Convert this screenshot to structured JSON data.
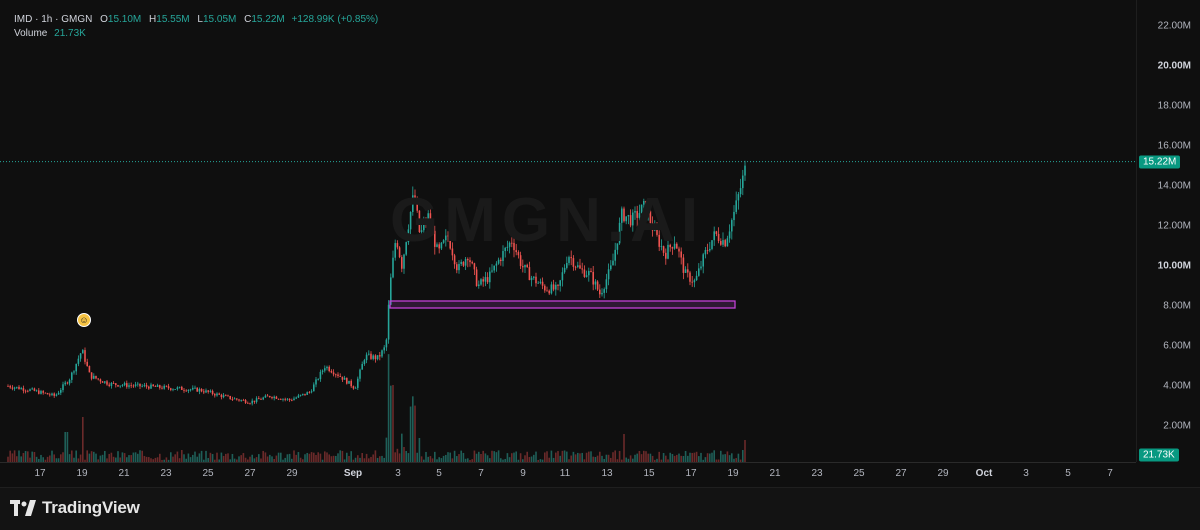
{
  "legend": {
    "symbol": "IMD · 1h · GMGN",
    "open_label": "O",
    "open": "15.10M",
    "high_label": "H",
    "high": "15.55M",
    "low_label": "L",
    "low": "15.05M",
    "close_label": "C",
    "close": "15.22M",
    "change": "+128.99K (+0.85%)",
    "volume_label": "Volume",
    "volume": "21.73K"
  },
  "watermark": "GMGN.AI",
  "price_axis": {
    "ticks": [
      "22.00M",
      "20.00M",
      "18.00M",
      "16.00M",
      "14.00M",
      "12.00M",
      "10.00M",
      "8.00M",
      "6.00M",
      "4.00M",
      "2.00M"
    ],
    "bold_ticks": [
      "20.00M",
      "10.00M"
    ],
    "current_price": "15.22M",
    "current_volume": "21.73K"
  },
  "time_axis": {
    "labels": [
      "17",
      "19",
      "21",
      "23",
      "25",
      "27",
      "29",
      "Sep",
      "3",
      "5",
      "7",
      "9",
      "11",
      "13",
      "15",
      "17",
      "19",
      "21",
      "23",
      "25",
      "27",
      "29",
      "Oct",
      "3",
      "5",
      "7"
    ],
    "bold_labels": [
      "Sep",
      "Oct"
    ]
  },
  "footer": {
    "brand": "TradingView"
  },
  "colors": {
    "up": "#26a69a",
    "down": "#ef5350",
    "zone": "#c241d6",
    "badge": "#089981"
  },
  "icons": {
    "event": "event-emoji-icon",
    "logo": "tradingview-logo-icon"
  },
  "chart_data": {
    "type": "candlestick",
    "interval": "1h",
    "ylim": [
      0,
      23000000
    ],
    "annotation_zone": {
      "price_low": 7900000,
      "price_high": 8250000,
      "start": "Sep 3",
      "end": "Sep 19"
    },
    "last_close": 15220000
  }
}
